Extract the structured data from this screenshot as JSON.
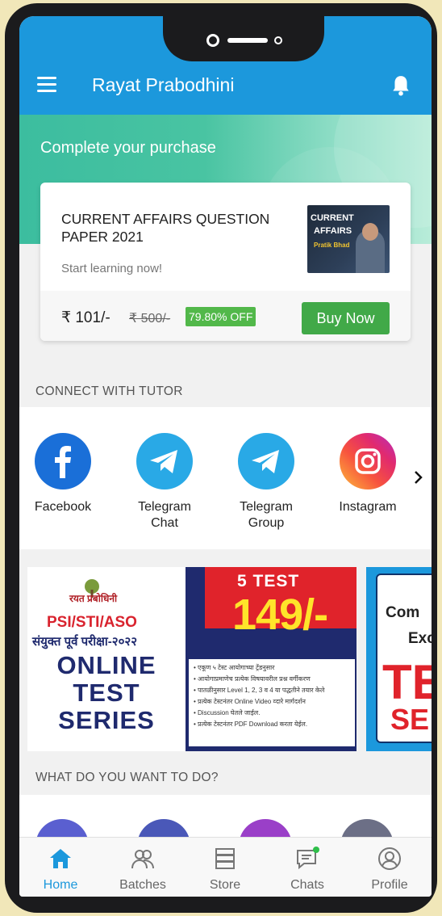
{
  "app": {
    "title": "Rayat Prabodhini"
  },
  "hero": {
    "title": "Complete your purchase"
  },
  "purchase": {
    "course_title": "CURRENT AFFAIRS QUESTION PAPER 2021",
    "subtitle": "Start learning now!",
    "thumbnail_line1": "CURRENT",
    "thumbnail_line2": "AFFAIRS",
    "thumbnail_name": "Pratik Bhad",
    "price": "₹ 101/-",
    "mrp": "₹ 500/-",
    "discount": "79.80% OFF",
    "buy_label": "Buy Now"
  },
  "connect": {
    "heading": "CONNECT WITH TUTOR",
    "items": [
      {
        "label": "Facebook",
        "icon": "facebook-icon"
      },
      {
        "label": "Telegram Chat",
        "icon": "telegram-icon"
      },
      {
        "label": "Telegram Group",
        "icon": "telegram-icon"
      },
      {
        "label": "Instagram",
        "icon": "instagram-icon"
      }
    ]
  },
  "banner1": {
    "logo_text": "रयत प्रबोधिनी",
    "exam": "PSI/STI/ASO",
    "hindi": "संयुक्त पूर्व परीक्षा-२०२२",
    "line1": "ONLINE",
    "line2": "TEST",
    "line3": "SERIES",
    "test_count": "5 TEST",
    "price": "149/-",
    "points": [
      "• एकूण ५ टेस्ट आयोगाच्या ट्रेंडनुसार",
      "• आयोगाप्रमाणेच प्रत्येक विषयावरील प्रश्न वर्गीकरण",
      "• पातळीनुसार Level 1, 2, 3 व 4 या पद्धतीने तयार केले",
      "• प्रत्येक टेस्टनंतर Online Video व्दारे मार्गदर्शन",
      "• Discussion घेतले जाईल.",
      "• प्रत्येक टेस्टनंतर PDF Download करता येईल."
    ]
  },
  "banner2": {
    "t1": "Com",
    "t2": "Exc",
    "t3": "TE",
    "t4": "SE"
  },
  "todo": {
    "heading": "WHAT DO YOU WANT TO DO?"
  },
  "nav": [
    {
      "label": "Home",
      "icon": "home-icon"
    },
    {
      "label": "Batches",
      "icon": "batches-icon"
    },
    {
      "label": "Store",
      "icon": "store-icon"
    },
    {
      "label": "Chats",
      "icon": "chat-icon"
    },
    {
      "label": "Profile",
      "icon": "profile-icon"
    }
  ],
  "colors": {
    "primary": "#1c98dc",
    "accent_green": "#41a948",
    "hero_green": "#3cbd9f"
  }
}
